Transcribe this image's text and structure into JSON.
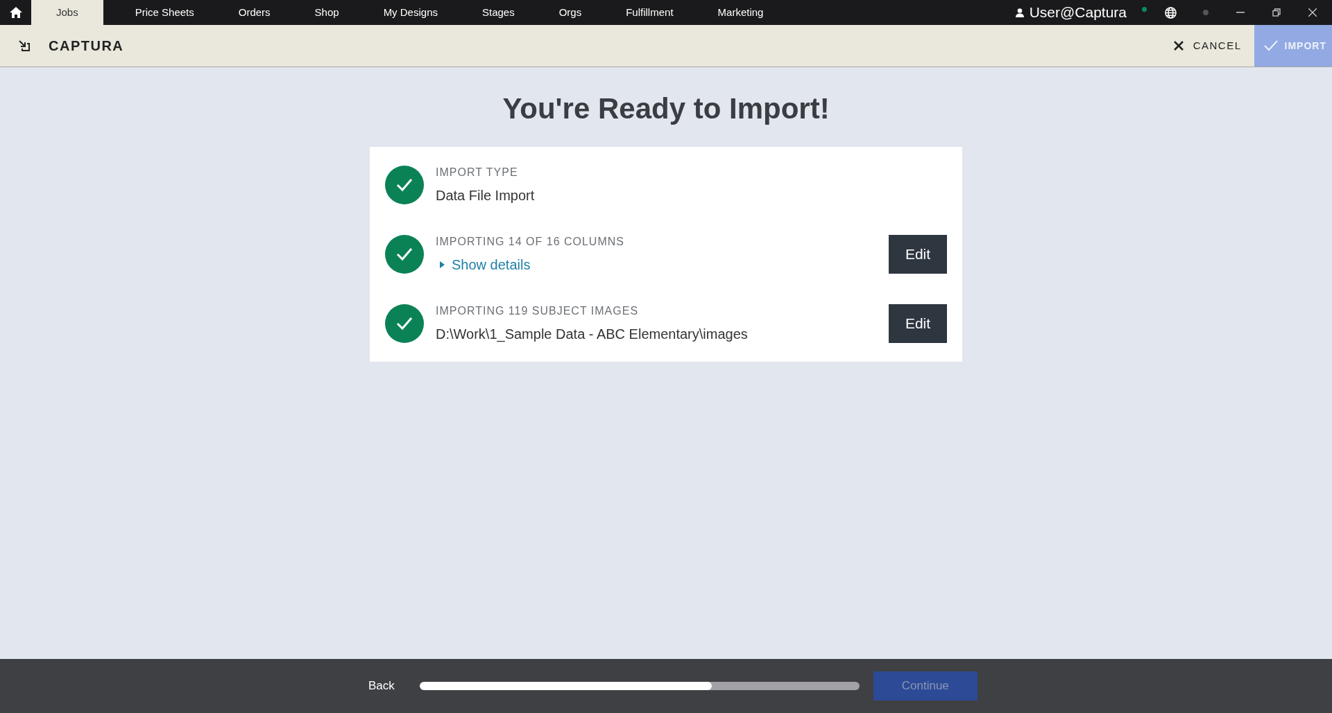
{
  "nav_tabs": [
    {
      "label": "Jobs",
      "selected": true
    },
    {
      "label": "Price Sheets",
      "selected": false
    },
    {
      "label": "Orders",
      "selected": false
    },
    {
      "label": "Shop",
      "selected": false
    },
    {
      "label": "My Designs",
      "selected": false
    },
    {
      "label": "Stages",
      "selected": false
    },
    {
      "label": "Orgs",
      "selected": false
    },
    {
      "label": "Fulfillment",
      "selected": false
    },
    {
      "label": "Marketing",
      "selected": false
    }
  ],
  "user": "User@Captura",
  "header": {
    "title": "CAPTURA",
    "cancel": "CANCEL",
    "import": {
      "label": "IMPORT",
      "disabled": true
    }
  },
  "heading": "You're Ready to Import!",
  "steps": [
    {
      "kind": "text",
      "label": "IMPORT TYPE",
      "value": "Data File Import",
      "done": true
    },
    {
      "kind": "details",
      "label": "IMPORTING 14 OF 16 COLUMNS",
      "value": "Show details",
      "expanded": false,
      "done": true,
      "edit": "Edit"
    },
    {
      "kind": "text",
      "label": "IMPORTING 119 SUBJECT IMAGES",
      "value": "D:\\Work\\1_Sample Data - ABC Elementary\\images",
      "done": true,
      "edit": "Edit"
    }
  ],
  "footer": {
    "back": "Back",
    "progress": {
      "level": 0.664
    },
    "continue": {
      "label": "Continue",
      "disabled": true
    }
  }
}
